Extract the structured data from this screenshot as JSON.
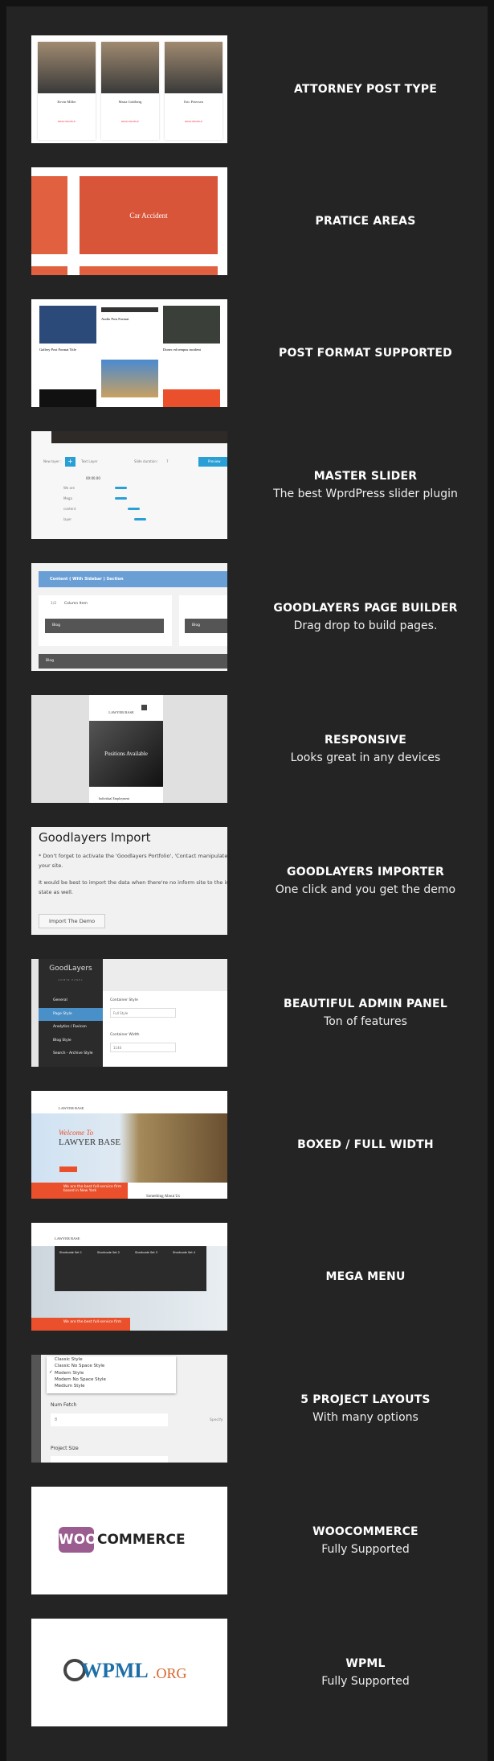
{
  "features": [
    {
      "title": "ATTORNEY POST TYPE",
      "subtitle": ""
    },
    {
      "title": "PRATICE AREAS",
      "subtitle": ""
    },
    {
      "title": "POST FORMAT SUPPORTED",
      "subtitle": ""
    },
    {
      "title": "MASTER SLIDER",
      "subtitle": "The best WprdPress slider plugin"
    },
    {
      "title": "GOODLAYERS PAGE BUILDER",
      "subtitle": "Drag drop to build pages."
    },
    {
      "title": "RESPONSIVE",
      "subtitle": "Looks great in any devices"
    },
    {
      "title": "GOODLAYERS IMPORTER",
      "subtitle": "One click and you get the demo"
    },
    {
      "title": "BEAUTIFUL ADMIN PANEL",
      "subtitle": "Ton of features"
    },
    {
      "title": "BOXED / FULL WIDTH",
      "subtitle": ""
    },
    {
      "title": "MEGA MENU",
      "subtitle": ""
    },
    {
      "title": "5 PROJECT LAYOUTS",
      "subtitle": "With many options"
    },
    {
      "title": "WOOCOMMERCE",
      "subtitle": "Fully Supported"
    },
    {
      "title": "WPML",
      "subtitle": "Fully Supported"
    }
  ],
  "thumbs": {
    "attorneys": [
      "Kevin Miller",
      "Maria Goldberg",
      "Eric Petersen"
    ],
    "practice": "Car Accident",
    "postformat": {
      "gallery": "Gallery Post Format Title",
      "audio": "Audio Post Format",
      "standard": "Donec ed tempus incident"
    },
    "slider": {
      "new_layer": "New layer :",
      "text_layer": "Text Layer",
      "slide_duration": "Slide duration :",
      "duration": "7",
      "unit": "s",
      "preview": "Preview",
      "time": "00:00.00",
      "layers": [
        "We are",
        "Mega",
        "content",
        "layer"
      ]
    },
    "builder": {
      "section": "Content ( With Sidebar ) Section",
      "fraction": "1/2",
      "column": "Column Item",
      "blog": "Blog"
    },
    "responsive": {
      "logo": "LAWYER BASE",
      "hero": "Positions Available",
      "item": "Individual Employment"
    },
    "importer": {
      "title": "Goodlayers Import",
      "p1": "* Don't forget to activate the 'Goodlayers Portfolio', 'Contact manipulate to your site.",
      "p2": "It would be best to import the data when there're no inform site to the initial state as well.",
      "button": "Import The Demo"
    },
    "admin": {
      "brand": "GoodLayers",
      "sub": "ADMIN PANEL",
      "menu": [
        "General",
        "Page Style",
        "Analytics / Favicon",
        "Blog Style",
        "Search - Archive Style"
      ],
      "active": 1,
      "label1": "Container Style",
      "value1": "Full Style",
      "label2": "Container Width",
      "value2": "1140"
    },
    "boxed": {
      "logo": "LAWYER BASE",
      "welcome": "Welcome To",
      "name": "LAWYER BASE",
      "banner": "We are the best full-service firm based in New York",
      "about": "Something About Us"
    },
    "mega": {
      "logo": "LAWYER BASE",
      "cols": [
        "Shortcode Set 1",
        "Shortcode Set 2",
        "Shortcode Set 3",
        "Shortcode Set 4"
      ],
      "banner": "We are the best full-service firm"
    },
    "layouts": {
      "options": [
        "Classic Style",
        "Classic No Space Style",
        "Modern Style",
        "Modern No Space Style",
        "Medium Style"
      ],
      "selected": 2,
      "num_label": "Num Fetch",
      "num_value": "8",
      "specify": "Specify",
      "size_label": "Project Size"
    },
    "woo": {
      "woo": "WOO",
      "commerce": "COMMERCE"
    },
    "wpml": {
      "wp": "WPML",
      ".org": ".ORG"
    }
  },
  "colors": {
    "accent": "#e9502b",
    "blue": "#2a9fd6",
    "bg": "#242424"
  }
}
